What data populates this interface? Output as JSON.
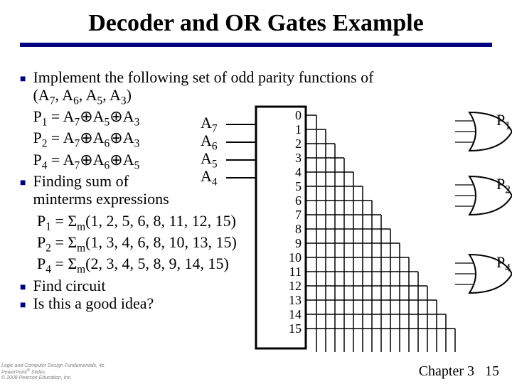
{
  "title": "Decoder and OR Gates Example",
  "bullets": {
    "b1_line1": "Implement the following set of odd parity functions of",
    "b1_line2": "(A",
    "b1_subs": [
      "7",
      ", A",
      "6",
      ", A",
      "5",
      ", A",
      "3",
      ")"
    ],
    "eq_p1": "P",
    "b2": "Finding sum of",
    "b2b": "minterms expressions",
    "sm_p1": "P",
    "b3": "Find circuit",
    "b4": "Is this a good idea?"
  },
  "eqs": {
    "p1_lhs": "P",
    "xor": "⊕"
  },
  "inputs": [
    "A",
    "A",
    "A",
    "A"
  ],
  "input_subs": [
    "7",
    "6",
    "5",
    "4"
  ],
  "dec_labels": [
    "0",
    "1",
    "2",
    "3",
    "4",
    "5",
    "6",
    "7",
    "8",
    "9",
    "10",
    "11",
    "12",
    "13",
    "14",
    "15"
  ],
  "gates": {
    "p1": "P",
    "p2": "P",
    "p4": "P"
  },
  "gate_subs": {
    "p1": "1",
    "p2": "2",
    "p4": "4"
  },
  "sum_eqs": {
    "p1": "1",
    "p1_rhs": " = Σ",
    "p1_list": "(1, 2, 5, 6, 8, 11, 12, 15)",
    "p2": "2",
    "p2_list": "(1, 3, 4, 6, 8, 10, 13, 15)",
    "p4": "4",
    "p4_list": "(2, 3, 4, 5, 8, 9, 14, 15)",
    "m": "m"
  },
  "footer": {
    "l1": "Logic and Computer Design Fundamentals, 4e",
    "l2": "PowerPoint",
    "l2b": " Slides",
    "l3": "© 2008 Pearson Education, Inc.",
    "chapter": "Chapter 3",
    "page": "15"
  }
}
